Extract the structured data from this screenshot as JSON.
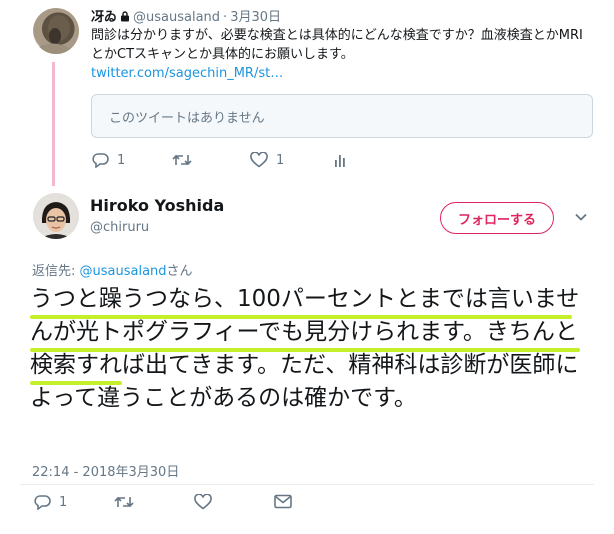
{
  "reply_tweet": {
    "name": "冴ゐ",
    "handle": "@usausaland",
    "date": "3月30日",
    "text": "問診は分かりますが、必要な検査とは具体的にどんな検査ですか？血液検査とかMRIとかCTスキャンとか具体的にお願いします。",
    "link": "twitter.com/sagechin_MR/st…",
    "quoted_unavailable": "このツイートはありません",
    "reply_count": "1",
    "like_count": "1"
  },
  "main_tweet": {
    "name": "Hiroko Yoshida",
    "handle": "@chiruru",
    "follow_label": "フォローする",
    "reply_to_prefix": "返信先: ",
    "reply_to_mention": "@usausaland",
    "reply_to_suffix": "さん",
    "text": "うつと躁うつなら、100パーセントとまでは言いませんが光トポグラフィーでも見分けられます。きちんと検索すれば出てきます。ただ、精神科は診断が医師によって違うことがあるのは確かです。",
    "timestamp": "22:14 - 2018年3月30日",
    "reply_count": "1"
  },
  "colors": {
    "accent_link": "#1b95e0",
    "follow_pink": "#e0245e",
    "thread_line": "#f2b8cf",
    "highlight_underline": "#c3f02a",
    "muted": "#657786"
  },
  "icons": [
    "lock-icon",
    "reply-icon",
    "retweet-icon",
    "like-icon",
    "analytics-icon",
    "caret-down-icon",
    "message-icon"
  ]
}
